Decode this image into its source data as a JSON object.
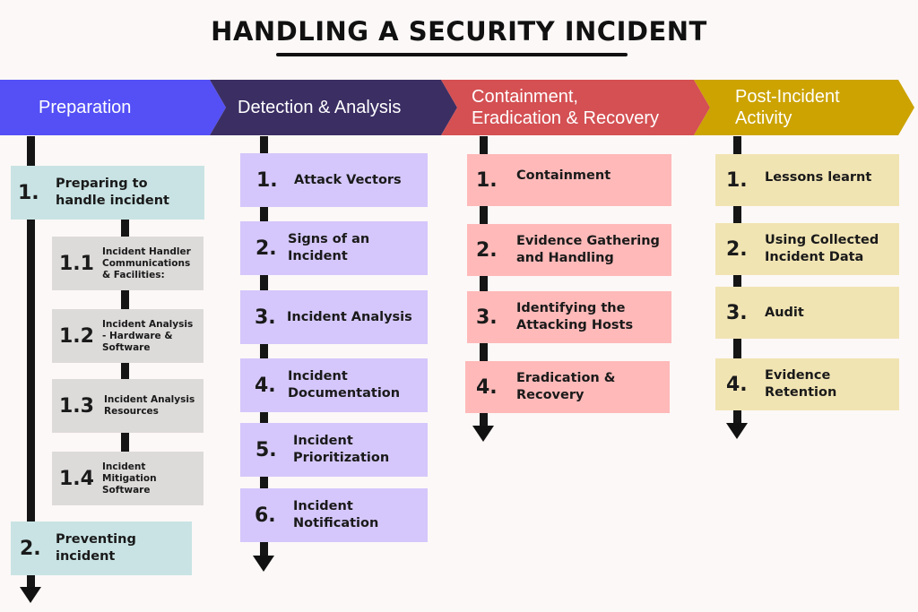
{
  "title": "HANDLING A SECURITY INCIDENT",
  "colors": {
    "preparation": "#5450f5",
    "detection": "#3b2e63",
    "containment": "#d45053",
    "post_incident": "#cca300"
  },
  "phases": [
    {
      "label": "Preparation"
    },
    {
      "label": "Detection & Analysis"
    },
    {
      "label_line1": "Containment,",
      "label_line2": "Eradication & Recovery"
    },
    {
      "label_line1": "Post-Incident",
      "label_line2": "Activity"
    }
  ],
  "preparation": {
    "steps": [
      {
        "num": "1.",
        "text": "Preparing to handle incident"
      },
      {
        "num": "2.",
        "text": "Preventing incident"
      }
    ],
    "substeps": [
      {
        "num": "1.1",
        "text": "Incident Handler Communications & Facilities:"
      },
      {
        "num": "1.2",
        "text": "Incident Analysis - Hardware & Software"
      },
      {
        "num": "1.3",
        "text": "Incident Analysis Resources"
      },
      {
        "num": "1.4",
        "text": "Incident Mitigation Software"
      }
    ]
  },
  "detection": {
    "steps": [
      {
        "num": "1.",
        "text": "Attack Vectors"
      },
      {
        "num": "2.",
        "text": "Signs of an Incident"
      },
      {
        "num": "3.",
        "text": "Incident Analysis"
      },
      {
        "num": "4.",
        "text": "Incident Documentation"
      },
      {
        "num": "5.",
        "text": "Incident Prioritization"
      },
      {
        "num": "6.",
        "text": "Incident Notification"
      }
    ]
  },
  "containment": {
    "steps": [
      {
        "num": "1.",
        "text": "Containment"
      },
      {
        "num": "2.",
        "text": "Evidence Gathering and Handling"
      },
      {
        "num": "3.",
        "text": "Identifying the Attacking Hosts"
      },
      {
        "num": "4.",
        "text": "Eradication & Recovery"
      }
    ]
  },
  "post_incident": {
    "steps": [
      {
        "num": "1.",
        "text": "Lessons learnt"
      },
      {
        "num": "2.",
        "text": "Using Collected Incident Data"
      },
      {
        "num": "3.",
        "text": "Audit"
      },
      {
        "num": "4.",
        "text": "Evidence Retention"
      }
    ]
  }
}
